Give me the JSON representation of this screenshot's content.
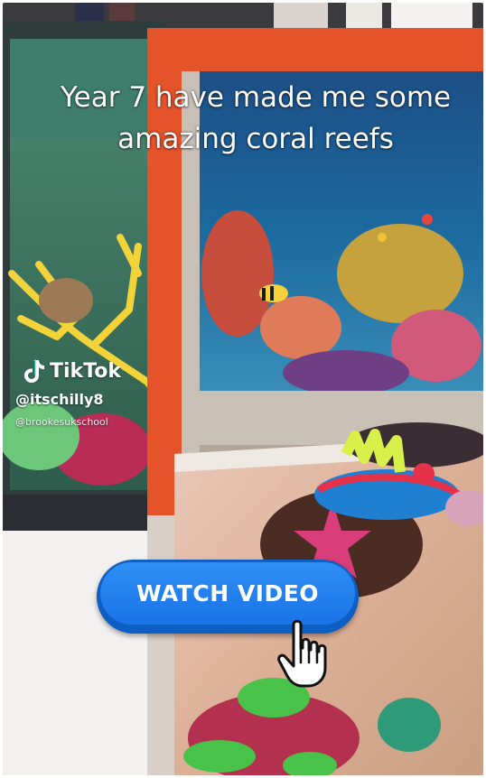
{
  "video": {
    "caption": "Year 7 have made me some amazing coral reefs",
    "watermark": {
      "logo_text": "TikTok",
      "handle": "@itschilly8",
      "handle_secondary": "@brookesukschool"
    }
  },
  "cta": {
    "label": "WATCH VIDEO",
    "color": "#1a73e8"
  },
  "icons": [
    "tiktok-logo-icon",
    "pointer-hand-icon"
  ]
}
